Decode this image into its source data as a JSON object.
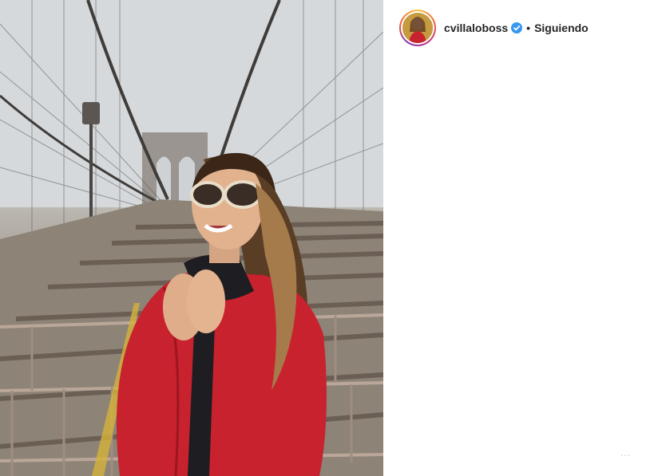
{
  "post": {
    "username": "cvillaloboss",
    "follow_status": "Siguiendo",
    "separator": "•",
    "more_options": "...",
    "verified": true,
    "avatar": "profile-avatar",
    "photo_subject": "woman-on-bridge-photo"
  },
  "colors": {
    "verified_blue": "#3897f0",
    "coat_red": "#c8222e",
    "text": "#262626"
  }
}
